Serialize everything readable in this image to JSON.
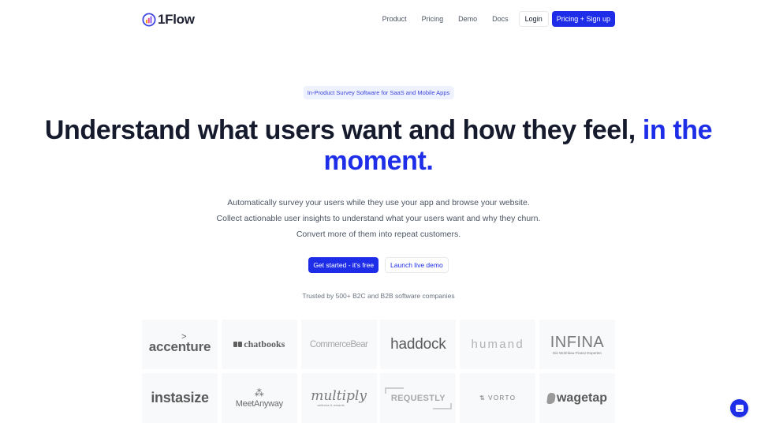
{
  "nav": {
    "brand": "1Flow",
    "links": [
      "Product",
      "Pricing",
      "Demo",
      "Docs"
    ],
    "login_label": "Login",
    "signup_label": "Pricing + Sign up"
  },
  "hero": {
    "badge": "In-Product Survey Software for SaaS and Mobile Apps",
    "headline_main": "Understand what users want and how they feel,",
    "headline_accent": "in the moment.",
    "subtext": [
      "Automatically survey your users while they use your app and browse your website.",
      "Collect actionable user insights to understand what your users want and why they churn.",
      "Convert more of them into repeat customers."
    ],
    "primary_cta": "Get started - it's free",
    "secondary_cta": "Launch live demo",
    "trusted_text": "Trusted by 500+ B2C and B2B software companies"
  },
  "customers": {
    "logos": [
      {
        "name": "accenture",
        "text": "accenture"
      },
      {
        "name": "chatbooks",
        "text": "chatbooks"
      },
      {
        "name": "commercebear",
        "text": "CommerceBear"
      },
      {
        "name": "haddock",
        "text": "haddock"
      },
      {
        "name": "humand",
        "text": "humand"
      },
      {
        "name": "infina",
        "text": "INFINA",
        "tagline": "Die Wohnbau-Finanz-Experten"
      },
      {
        "name": "instasize",
        "text": "instasize"
      },
      {
        "name": "meetanyway",
        "text": "MeetAnyway"
      },
      {
        "name": "multiply",
        "text": "multiply",
        "tagline": "wellness & rewards"
      },
      {
        "name": "requestly",
        "text": "REQUESTLY"
      },
      {
        "name": "vorto",
        "text": "VORTO"
      },
      {
        "name": "wagetap",
        "text": "wagetap"
      }
    ]
  },
  "widgets": {
    "chat_icon": "chat-bubble-icon"
  },
  "colors": {
    "brand_blue": "#1e2ee8",
    "heading": "#151a2d",
    "body_text": "#4b5563",
    "badge_bg": "#eef2ff",
    "tile_bg": "#f8f9fb"
  }
}
